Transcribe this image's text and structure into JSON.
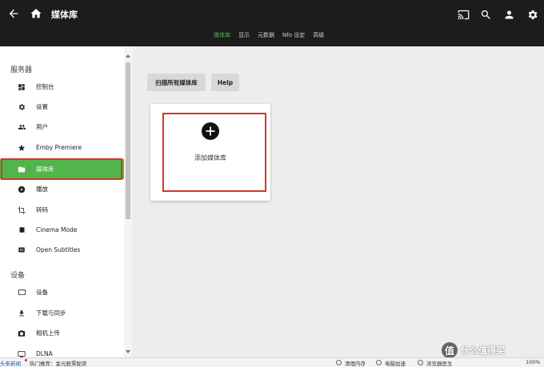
{
  "header": {
    "title": "媒体库",
    "tabs": [
      {
        "label": "媒体库",
        "active": true
      },
      {
        "label": "显示",
        "active": false
      },
      {
        "label": "元数据",
        "active": false
      },
      {
        "label": "Nfo 设定",
        "active": false
      },
      {
        "label": "高级",
        "active": false
      }
    ],
    "icons": [
      "arrow-back-icon",
      "home-icon",
      "cast-icon",
      "search-icon",
      "user-icon",
      "gear-icon"
    ]
  },
  "sidebar": {
    "section_server": "服务器",
    "section_devices": "设备",
    "items": [
      {
        "label": "控制台",
        "icon": "dashboard-icon"
      },
      {
        "label": "设置",
        "icon": "gear-icon"
      },
      {
        "label": "用户",
        "icon": "people-icon"
      },
      {
        "label": "Emby Premiere",
        "icon": "star-icon"
      },
      {
        "label": "媒体库",
        "icon": "folder-icon",
        "active": true
      },
      {
        "label": "播放",
        "icon": "play-circle-icon"
      },
      {
        "label": "转码",
        "icon": "crop-icon"
      },
      {
        "label": "Cinema Mode",
        "icon": "film-icon"
      },
      {
        "label": "Open Subtitles",
        "icon": "subtitles-icon"
      }
    ],
    "device_items": [
      {
        "label": "设备",
        "icon": "tv-icon"
      },
      {
        "label": "下载与同步",
        "icon": "download-icon"
      },
      {
        "label": "相机上传",
        "icon": "camera-icon"
      },
      {
        "label": "DLNA",
        "icon": "dlna-icon"
      }
    ]
  },
  "main": {
    "scan_button": "扫描所有媒体库",
    "help_button": "Help",
    "add_library_label": "添加媒体库"
  },
  "statusbar": {
    "news": "头条新闻",
    "hot": "热门推荐：金元股票配资",
    "clean": "清理内存",
    "speed": "电脑加速",
    "doctor": "浏览器医生",
    "zoom": "100%"
  },
  "watermark": {
    "badge": "值",
    "text": "什么值得买"
  },
  "colors": {
    "accent": "#52b54b",
    "header_bg": "#1c1c1c",
    "highlight_red": "#d9342b"
  }
}
